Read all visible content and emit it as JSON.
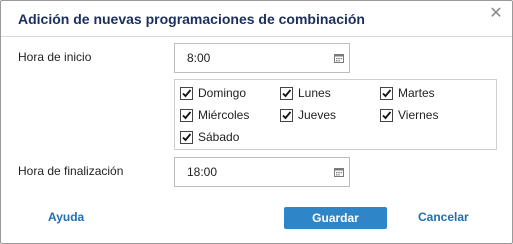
{
  "dialog": {
    "title": "Adición de nuevas programaciones de combinación",
    "close_icon": "close-icon"
  },
  "start_time": {
    "label": "Hora de inicio",
    "value": "8:00",
    "icon": "calendar-icon"
  },
  "days": [
    {
      "label": "Domingo",
      "checked": true
    },
    {
      "label": "Lunes",
      "checked": true
    },
    {
      "label": "Martes",
      "checked": true
    },
    {
      "label": "Miércoles",
      "checked": true
    },
    {
      "label": "Jueves",
      "checked": true
    },
    {
      "label": "Viernes",
      "checked": true
    },
    {
      "label": "Sábado",
      "checked": true
    }
  ],
  "end_time": {
    "label": "Hora de finalización",
    "value": "18:00",
    "icon": "calendar-icon"
  },
  "footer": {
    "help_label": "Ayuda",
    "save_label": "Guardar",
    "cancel_label": "Cancelar"
  },
  "colors": {
    "title": "#1b2f5e",
    "primary_button": "#2e86c9",
    "link": "#1f6fb5"
  }
}
